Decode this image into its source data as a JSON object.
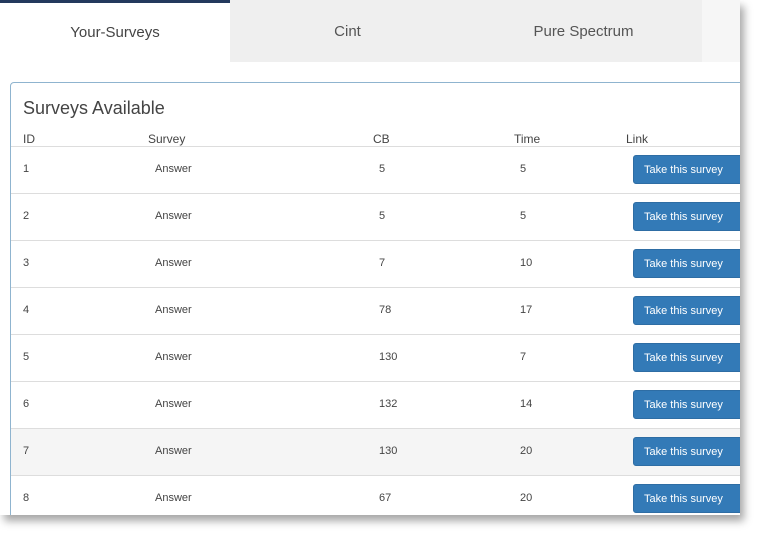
{
  "tabs": [
    {
      "label": "Your-Surveys",
      "active": true
    },
    {
      "label": "Cint",
      "active": false
    },
    {
      "label": "Pure Spectrum",
      "active": false
    }
  ],
  "panel": {
    "title": "Surveys Available",
    "columns": [
      "ID",
      "Survey",
      "CB",
      "Time",
      "Link"
    ],
    "rows": [
      {
        "id": "1",
        "survey": "Answer",
        "cb": "5",
        "time": "5",
        "link": "Take this survey"
      },
      {
        "id": "2",
        "survey": "Answer",
        "cb": "5",
        "time": "5",
        "link": "Take this survey"
      },
      {
        "id": "3",
        "survey": "Answer",
        "cb": "7",
        "time": "10",
        "link": "Take this survey"
      },
      {
        "id": "4",
        "survey": "Answer",
        "cb": "78",
        "time": "17",
        "link": "Take this survey"
      },
      {
        "id": "5",
        "survey": "Answer",
        "cb": "130",
        "time": "7",
        "link": "Take this survey"
      },
      {
        "id": "6",
        "survey": "Answer",
        "cb": "132",
        "time": "14",
        "link": "Take this survey"
      },
      {
        "id": "7",
        "survey": "Answer",
        "cb": "130",
        "time": "20",
        "link": "Take this survey"
      },
      {
        "id": "8",
        "survey": "Answer",
        "cb": "67",
        "time": "20",
        "link": "Take this survey"
      }
    ]
  },
  "colors": {
    "accent": "#337ab7",
    "active_tab_border": "#23395d",
    "panel_border": "#8fb4cf",
    "striped_row": "#f5f5f5"
  }
}
